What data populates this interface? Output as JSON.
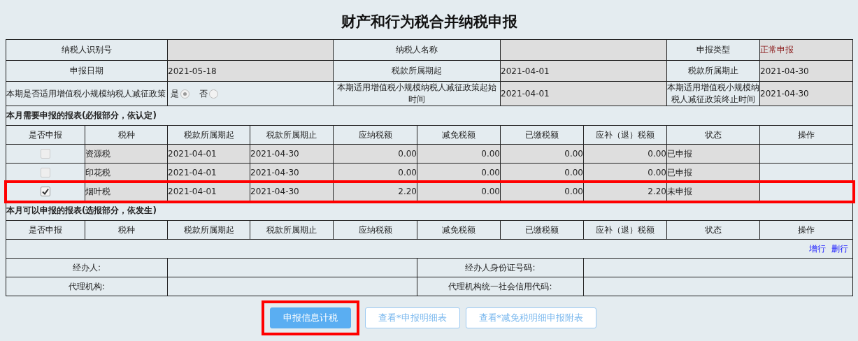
{
  "title": "财产和行为税合并纳税申报",
  "info_rows": [
    [
      {
        "label": "纳税人识别号"
      },
      {
        "label": "纳税人名称"
      },
      {
        "label": "申报类型",
        "value": "正常申报",
        "kind": "status"
      }
    ],
    [
      {
        "label": "申报日期",
        "value": "2021-05-18"
      },
      {
        "label": "税款所属期起",
        "value": "2021-04-01"
      },
      {
        "label": "税款所属期止",
        "value": "2021-04-30"
      }
    ]
  ],
  "policy_row": {
    "label": "本期是否适用增值税小规模纳税人减征政策",
    "options": [
      {
        "label": "是",
        "selected": true
      },
      {
        "label": "否",
        "selected": false
      }
    ],
    "start_label": "本期适用增值税小规模纳税人减征政策起始时间",
    "start_value": "2021-04-01",
    "end_label": "本期适用增值税小规模纳税人减征政策终止时间",
    "end_value": "2021-04-30"
  },
  "required_section": {
    "title": "本月需要申报的报表(必报部分，依认定)",
    "columns": [
      "是否申报",
      "税种",
      "税款所属期起",
      "税款所属期止",
      "应纳税额",
      "减免税额",
      "已缴税额",
      "应补（退）税额",
      "状态",
      "操作"
    ],
    "rows": [
      {
        "checked": false,
        "highlighted": false,
        "cells": [
          "",
          "资源税",
          "2021-04-01",
          "2021-04-30",
          "0.00",
          "0.00",
          "0.00",
          "0.00",
          "已申报",
          ""
        ]
      },
      {
        "checked": false,
        "highlighted": false,
        "cells": [
          "",
          "印花税",
          "2021-04-01",
          "2021-04-30",
          "0.00",
          "0.00",
          "0.00",
          "0.00",
          "已申报",
          ""
        ]
      },
      {
        "checked": true,
        "highlighted": true,
        "cells": [
          "",
          "烟叶税",
          "2021-04-01",
          "2021-04-30",
          "2.20",
          "0.00",
          "0.00",
          "2.20",
          "未申报",
          ""
        ]
      }
    ]
  },
  "optional_section": {
    "title": "本月可以申报的报表(选报部分，依发生)",
    "columns": [
      "是否申报",
      "税种",
      "税款所属期起",
      "税款所属期止",
      "应纳税额",
      "减免税额",
      "已缴税额",
      "应补（退）税额",
      "状态",
      "操作"
    ],
    "links": [
      "增行",
      "删行"
    ]
  },
  "agent_rows": [
    [
      {
        "label": "经办人:"
      },
      {
        "label": "经办人身份证号码:"
      }
    ],
    [
      {
        "label": "代理机构:"
      },
      {
        "label": "代理机构统一社会信用代码:"
      }
    ]
  ],
  "buttons": [
    {
      "label": "申报信息计税",
      "kind": "primary",
      "highlighted": true
    },
    {
      "label": "查看*申报明细表",
      "kind": "outline",
      "highlighted": false
    },
    {
      "label": "查看*减免税明细申报附表",
      "kind": "outline",
      "highlighted": false
    }
  ]
}
